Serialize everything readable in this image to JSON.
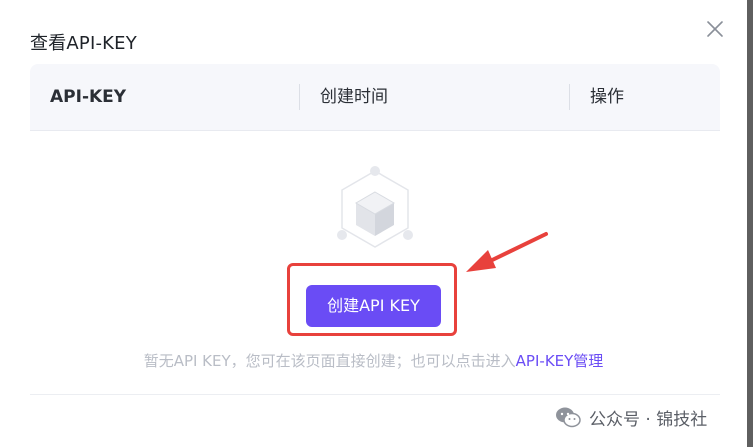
{
  "dialog": {
    "title": "查看API-KEY"
  },
  "table": {
    "columns": [
      "API-KEY",
      "创建时间",
      "操作"
    ]
  },
  "empty_state": {
    "create_button_label": "创建API KEY",
    "hint_prefix": "暂无API KEY，您可在该页面直接创建；也可以点击进入",
    "hint_link": "API-KEY管理"
  },
  "watermark": {
    "text": "公众号 · 锦技社"
  },
  "colors": {
    "accent": "#6a4cf5",
    "annotation_red": "#e8413c",
    "hint_text": "#b9bdc6"
  }
}
